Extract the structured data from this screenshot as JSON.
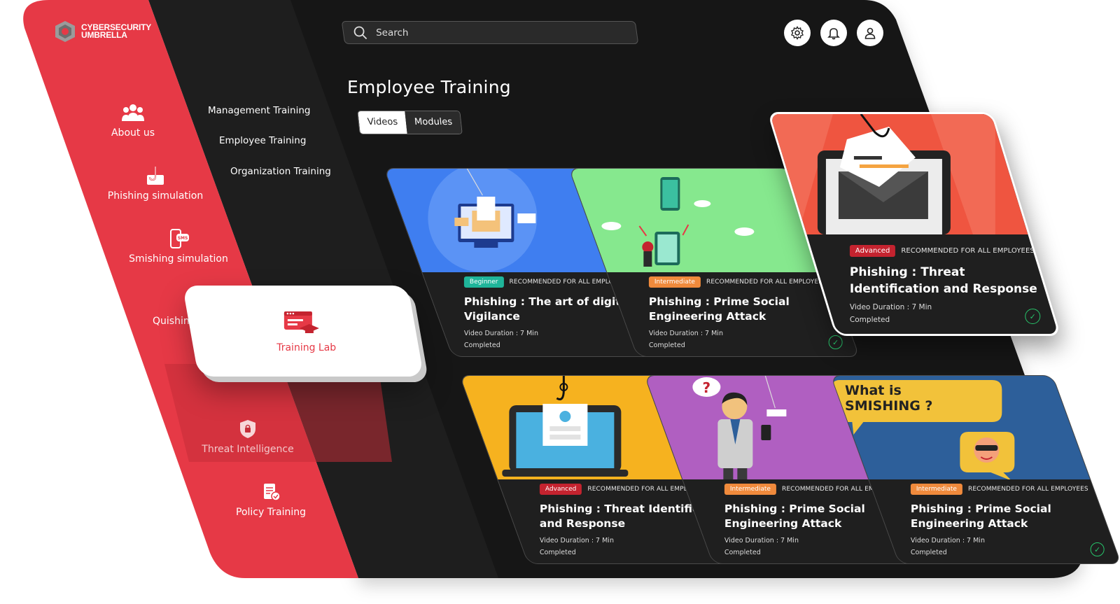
{
  "brand": {
    "name_line1": "CYBERSECURITY",
    "name_line2": "UMBRELLA"
  },
  "sidebar": {
    "items": [
      {
        "label": "About us",
        "icon": "users-icon"
      },
      {
        "label": "Phishing simulation",
        "icon": "phishing-hook-icon"
      },
      {
        "label": "Smishing simulation",
        "icon": "sms-phone-icon"
      },
      {
        "label": "Quishing",
        "icon": "qr-icon"
      },
      {
        "label": "Threat Intelligence",
        "icon": "shield-lock-icon"
      },
      {
        "label": "Policy Training",
        "icon": "policy-document-icon"
      }
    ],
    "active": {
      "label": "Training Lab",
      "icon": "training-lab-icon"
    }
  },
  "subnav": {
    "items": [
      "Management Training",
      "Employee Training",
      "Organization Training"
    ]
  },
  "search": {
    "placeholder": "Search"
  },
  "header_icons": [
    "gear-icon",
    "bell-icon",
    "user-icon"
  ],
  "page": {
    "title": "Employee Training",
    "tabs": [
      {
        "label": "Videos",
        "active": true
      },
      {
        "label": "Modules",
        "active": false
      }
    ]
  },
  "cards": [
    {
      "level": "Beginner",
      "rec": "RECOMMENDED FOR ALL EMPLOYEES",
      "title": "Phishing : The art of digital Vigilance",
      "duration": "Video Duration : 7 Min",
      "status": "Completed",
      "bg": "#3f7ef0"
    },
    {
      "level": "Intermediate",
      "rec": "RECOMMENDED FOR ALL EMPLOYEES",
      "title": "Phishing : Prime Social Engineering Attack",
      "duration": "Video Duration : 7 Min",
      "status": "Completed",
      "bg": "#86e88e"
    },
    {
      "level": "Advanced",
      "rec": "RECOMMENDED FOR ALL EMPLOYEES",
      "title": "Phishing : Threat Identification and Response",
      "duration": "Video Duration : 7 Min",
      "status": "Completed",
      "bg": "#ef5540"
    },
    {
      "level": "Advanced",
      "rec": "RECOMMENDED FOR ALL EMPLOYEES",
      "title": "Phishing : Threat Identification and Response",
      "duration": "Video Duration : 7 Min",
      "status": "Completed",
      "bg": "#f6b21f"
    },
    {
      "level": "Intermediate",
      "rec": "RECOMMENDED FOR ALL EMPLOYEES",
      "title": "Phishing : Prime Social Engineering Attack",
      "duration": "Video Duration : 7 Min",
      "status": "Completed",
      "bg": "#b05fc1"
    },
    {
      "level": "Intermediate",
      "rec": "RECOMMENDED FOR ALL EMPLOYEES",
      "title": "Phishing : Prime Social Engineering Attack",
      "duration": "Video Duration : 7 Min",
      "status": "Completed",
      "bg": "#2d5f9a",
      "bubble": "What is SMISHING ?"
    }
  ],
  "colors": {
    "brand_red": "#e63946",
    "dark": "#1c1c1c",
    "darker": "#141414",
    "success": "#27c56b"
  }
}
